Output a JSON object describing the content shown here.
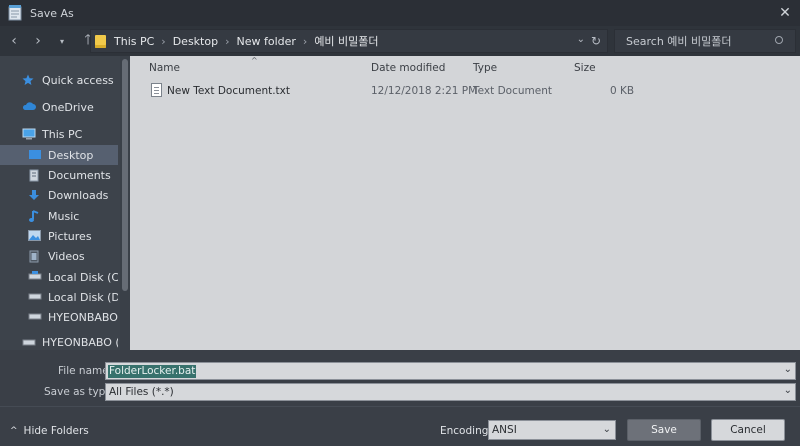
{
  "window": {
    "title": "Save As"
  },
  "nav": {
    "breadcrumb": [
      "This PC",
      "Desktop",
      "New folder",
      "예비 비밀폴더"
    ],
    "search_placeholder": "Search 예비 비밀폴더"
  },
  "sidebar": {
    "items": [
      {
        "label": "Quick access",
        "icon": "star-icon"
      },
      {
        "label": "OneDrive",
        "icon": "cloud-icon"
      },
      {
        "label": "This PC",
        "icon": "computer-icon"
      },
      {
        "label": "Desktop",
        "icon": "desktop-icon",
        "selected": true
      },
      {
        "label": "Documents",
        "icon": "document-icon"
      },
      {
        "label": "Downloads",
        "icon": "download-icon"
      },
      {
        "label": "Music",
        "icon": "music-icon"
      },
      {
        "label": "Pictures",
        "icon": "picture-icon"
      },
      {
        "label": "Videos",
        "icon": "video-icon"
      },
      {
        "label": "Local Disk (C:)",
        "icon": "drive-icon"
      },
      {
        "label": "Local Disk (D:)",
        "icon": "drive-icon"
      },
      {
        "label": "HYEONBABO (E:)",
        "icon": "drive-icon"
      },
      {
        "label": "HYEONBABO (E:)",
        "icon": "drive-icon"
      }
    ]
  },
  "filelist": {
    "columns": [
      "Name",
      "Date modified",
      "Type",
      "Size"
    ],
    "rows": [
      {
        "name": "New Text Document.txt",
        "date": "12/12/2018 2:21 PM",
        "type": "Text Document",
        "size": "0 KB"
      }
    ]
  },
  "form": {
    "file_name_label": "File name:",
    "file_name_value": "FolderLocker.bat",
    "save_type_label": "Save as type:",
    "save_type_value": "All Files  (*.*)",
    "encoding_label": "Encoding:",
    "encoding_value": "ANSI"
  },
  "buttons": {
    "hide_folders": "Hide Folders",
    "save": "Save",
    "cancel": "Cancel"
  },
  "colors": {
    "selected_bg": "#566070",
    "filelist_bg": "#d3d5d8",
    "selection": "#37716c"
  }
}
